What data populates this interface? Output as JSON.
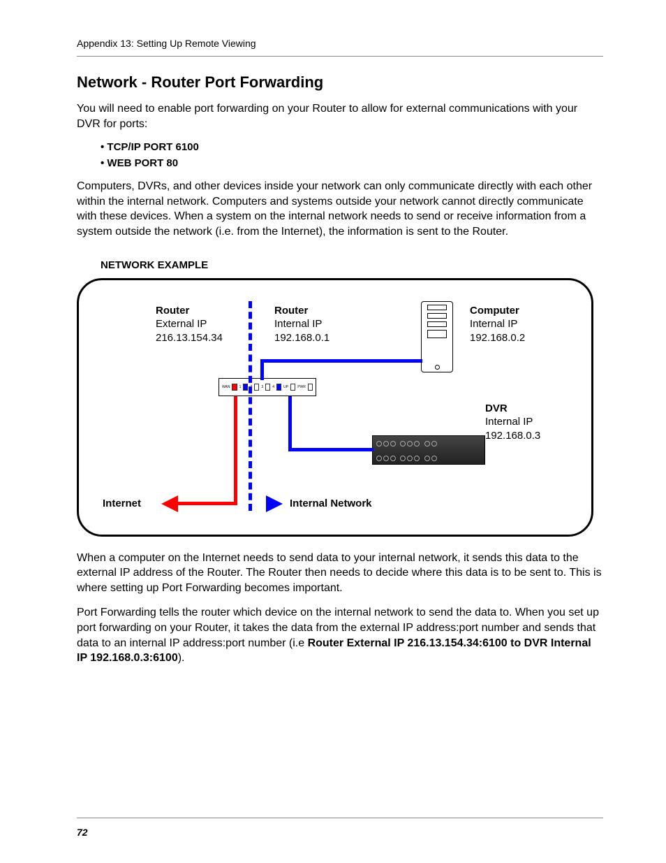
{
  "header": "Appendix 13: Setting Up Remote Viewing",
  "title": "Network - Router Port Forwarding",
  "intro": "You will need to enable port forwarding on your Router to allow for external communications with your DVR for ports:",
  "ports": [
    "• TCP/IP PORT 6100",
    "• WEB PORT 80"
  ],
  "para1": "Computers, DVRs, and other devices inside your network can only communicate directly with each other within the internal network. Computers and systems outside your network cannot directly communicate with these devices. When a system on the internal network needs to send or receive information from a system outside the network (i.e. from the Internet), the information is sent to the Router.",
  "exampleTitle": "NETWORK EXAMPLE",
  "diagram": {
    "routerExt": {
      "title": "Router",
      "sub": "External IP",
      "ip": "216.13.154.34"
    },
    "routerInt": {
      "title": "Router",
      "sub": "Internal IP",
      "ip": "192.168.0.1"
    },
    "computer": {
      "title": "Computer",
      "sub": "Internal IP",
      "ip": "192.168.0.2"
    },
    "dvr": {
      "title": "DVR",
      "sub": "Internal IP",
      "ip": "192.168.0.3"
    },
    "internet": "Internet",
    "internal": "Internal Network",
    "routerPorts": {
      "wan": "WAN",
      "p1": "1",
      "p2": "2",
      "p3": "3",
      "p4": "4",
      "up": "UP",
      "pwr": "PWR"
    }
  },
  "para2": "When a computer on the Internet needs to send data to your internal network, it sends this data to the external IP address of the Router. The Router then needs to decide where this data is to be sent to. This is where setting up Port Forwarding becomes important.",
  "para3a": "Port Forwarding tells the router which device on the internal network to send the data to. When you set up port forwarding on your Router, it takes the data from the external IP address:port number and sends that data to an internal IP address:port number (i.e ",
  "para3bold": "Router External IP 216.13.154.34:6100 to DVR Internal IP 192.168.0.3:6100",
  "para3b": ").",
  "pageNumber": "72"
}
